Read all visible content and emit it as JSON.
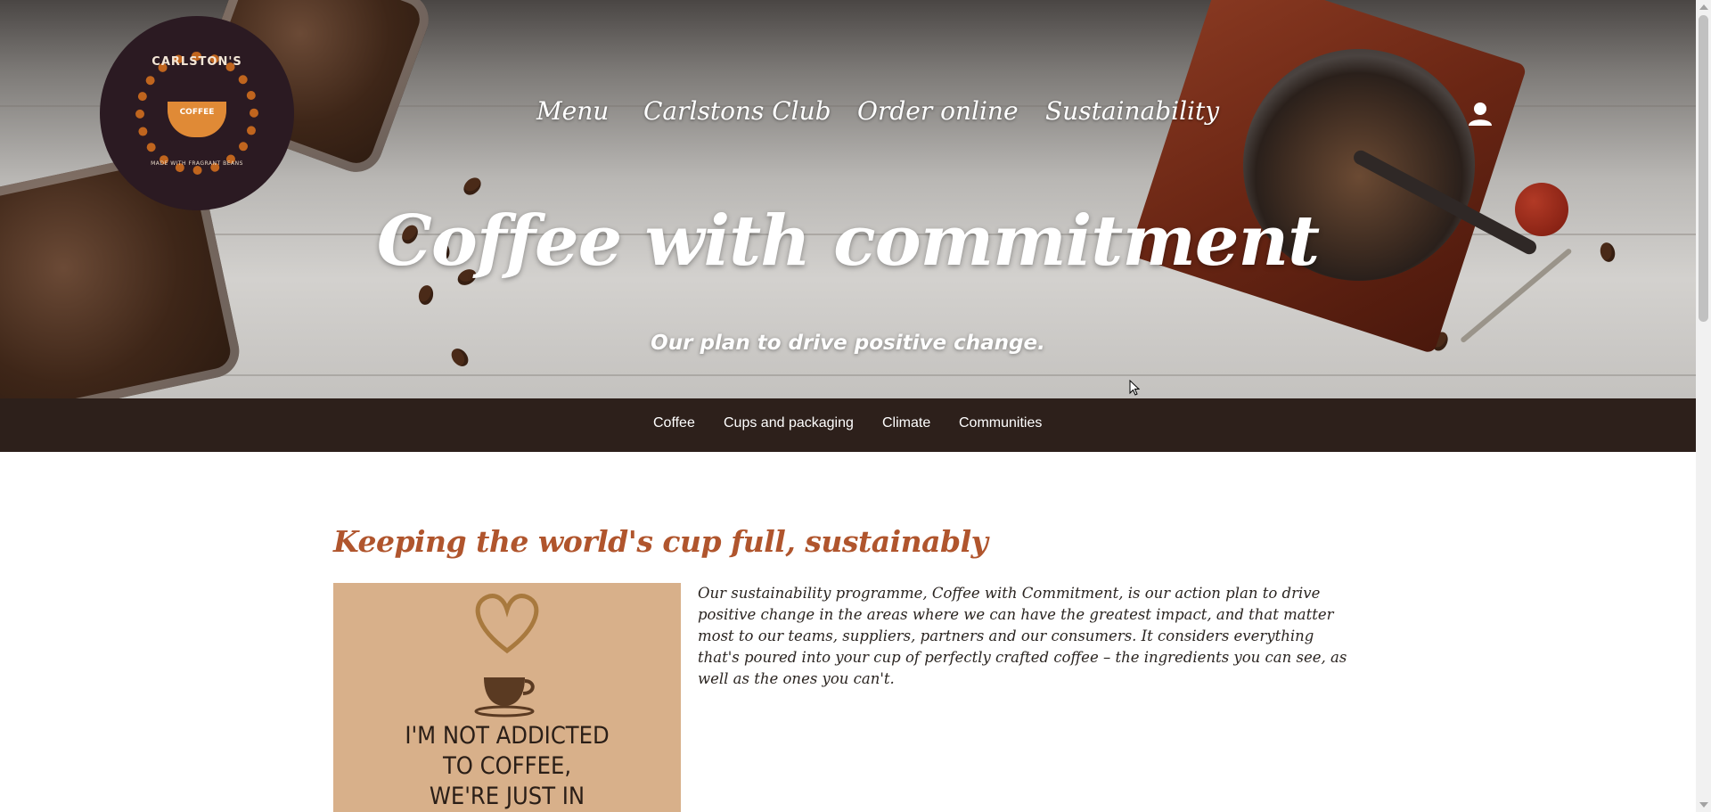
{
  "brand": {
    "name": "CARLSTON'S",
    "word": "COFFEE",
    "tagline": "MADE WITH FRAGRANT BEANS"
  },
  "nav": {
    "items": [
      "Menu",
      "Carlstons Club",
      "Order online",
      "Sustainability"
    ]
  },
  "icons": {
    "account": "user-icon"
  },
  "hero": {
    "title": "Coffee with commitment",
    "subtitle": "Our plan to drive positive change."
  },
  "subnav": {
    "items": [
      "Coffee",
      "Cups and packaging",
      "Climate",
      "Communities"
    ]
  },
  "content": {
    "heading": "Keeping the world's cup full, sustainably",
    "paragraph": "Our sustainability programme, Coffee with Commitment, is our action plan to drive positive change in the areas where we can have the greatest impact, and that matter most to our teams, suppliers, partners and our consumers. It considers everything that's poured into your cup of perfectly crafted coffee – the ingredients you can see, as well as the ones you can't.",
    "poster_lines": [
      "I'M NOT ADDICTED",
      "TO COFFEE,",
      "WE'RE JUST IN"
    ]
  },
  "colors": {
    "accent": "#b0552d",
    "subnav_bg": "#2d201b",
    "logo_bg": "#2b1a22"
  }
}
